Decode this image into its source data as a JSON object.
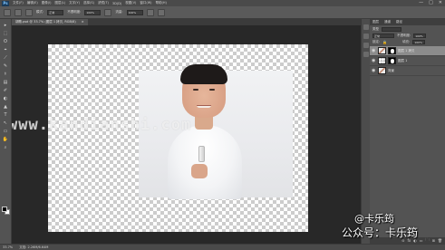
{
  "menubar": {
    "logo": "Ps",
    "items": [
      "文件(F)",
      "编辑(E)",
      "图像(I)",
      "图层(L)",
      "文字(Y)",
      "选择(S)",
      "滤镜(T)",
      "3D(D)",
      "视图(V)",
      "窗口(W)",
      "帮助(H)"
    ],
    "controls": [
      "—",
      "□",
      "✕"
    ]
  },
  "options": {
    "mode_label": "模式:",
    "mode_value": "正常",
    "opacity_label": "不透明度:",
    "opacity_value": "100%",
    "flow_label": "流量:",
    "flow_value": "100%"
  },
  "document": {
    "tab_title": "胡歌.psd @ 33.7% (图层 1 拷贝, RGB/8)",
    "tab_close": "×",
    "watermark": "www.kandianshi.com"
  },
  "toolbar": {
    "tools": [
      "▸",
      "⬚",
      "ʘ",
      "⌖",
      "⟋",
      "✎",
      "⚕",
      "▤",
      "✐",
      "◐",
      "▲",
      "T",
      "↖",
      "▭",
      "✋",
      "⌕"
    ]
  },
  "layers_panel": {
    "tabs": [
      "图层",
      "通道",
      "路径"
    ],
    "kind_label": "类型",
    "blend_value": "正常",
    "opacity_label": "不透明度:",
    "opacity_value": "100%",
    "lock_label": "锁定:",
    "fill_label": "填充:",
    "fill_value": "100%",
    "layers": [
      {
        "name": "图层 1 拷贝",
        "selected": true
      },
      {
        "name": "图层 1",
        "selected": false
      },
      {
        "name": "背景",
        "selected": false
      }
    ],
    "footer_icons": [
      "⊝",
      "fx",
      "◐",
      "▭",
      "🗀",
      "⊞",
      "🗑"
    ]
  },
  "status": {
    "zoom": "33.7%",
    "doc_info": "文档: 2.26M/6.64M"
  },
  "credits": {
    "line1": "@卡乐筠",
    "line2": "公众号：卡乐筠"
  }
}
